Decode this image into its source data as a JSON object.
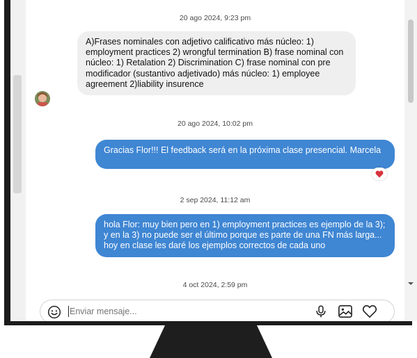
{
  "messages": [
    {
      "timestamp": "20 ago 2024, 9:23 pm",
      "direction": "in",
      "text": "A)Frases nominales con adjetivo calificativo más núcleo: 1) employment practices 2) wrongful termination B) frase nominal con núcleo: 1) Retalation 2) Discrimination C) frase nominal con pre modificador (sustantivo adjetivado) más núcleo: 1) employee agreement 2)liability insurence"
    },
    {
      "timestamp": "20 ago 2024, 10:02 pm",
      "direction": "out",
      "text": "Gracias Flor!!! El feedback será en la próxima clase presencial. Marcela",
      "reaction": "heart-icon"
    },
    {
      "timestamp": "2 sep 2024, 11:12 am",
      "direction": "out",
      "text": "hola Flor: muy bien pero en 1) employment practices es ejemplo de la 3); y en la 3) no puede ser el último porque es parte de una FN más larga... hoy en clase les daré los ejemplos correctos de cada uno"
    },
    {
      "timestamp": "4 oct 2024, 2:59 pm"
    }
  ],
  "composer": {
    "placeholder": "Enviar mensaje...",
    "icons": [
      "emoji-icon",
      "microphone-icon",
      "image-icon",
      "heart-icon"
    ]
  },
  "colors": {
    "outgoing_bubble": "#3f86d3",
    "incoming_bubble": "#efefef",
    "reaction_heart": "#d8323c",
    "monitor_frame": "#1c1c1c"
  }
}
